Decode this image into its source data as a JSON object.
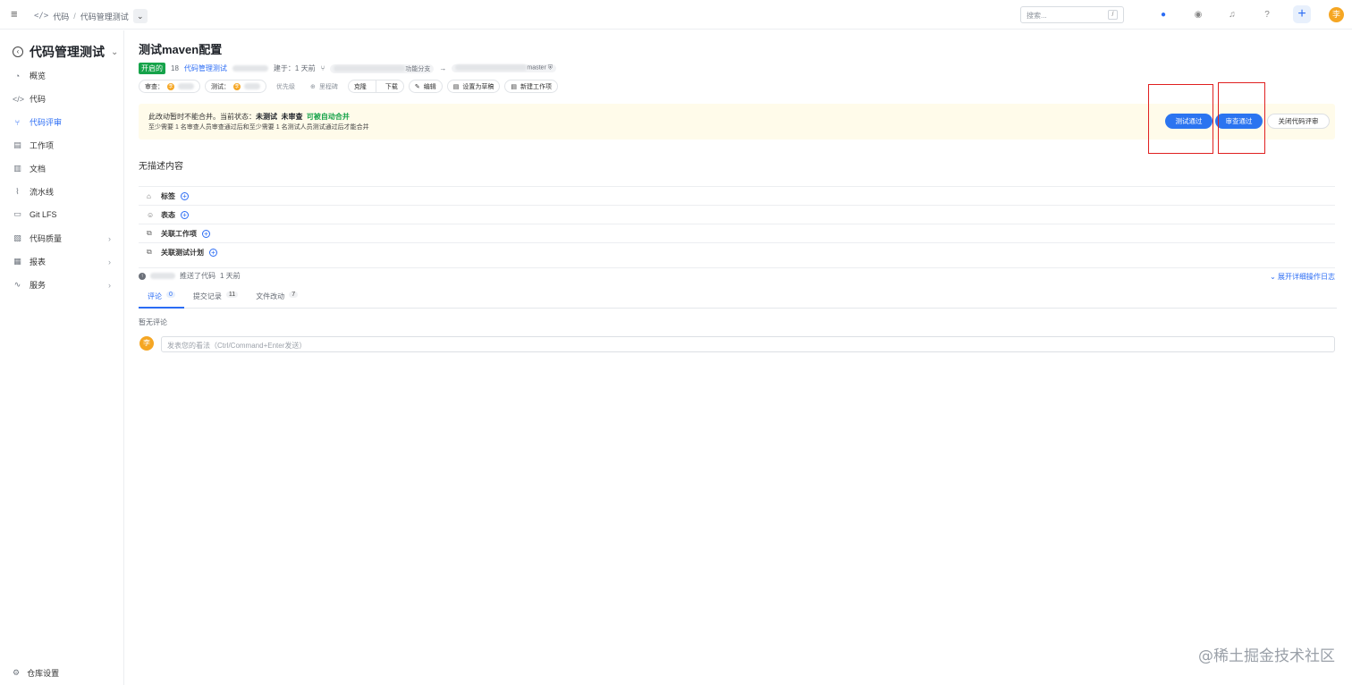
{
  "topbar": {
    "breadcrumb": [
      "代码",
      "代码管理测试"
    ],
    "search_placeholder": "搜索...",
    "search_shortcut": "/",
    "avatar_letter": "李",
    "help_label": "?"
  },
  "sidebar": {
    "project_title": "代码管理测试",
    "items": [
      {
        "label": "概览",
        "icon": "dashboard-icon"
      },
      {
        "label": "代码",
        "icon": "code-icon"
      },
      {
        "label": "代码评审",
        "icon": "merge-request-icon",
        "active": true
      },
      {
        "label": "工作项",
        "icon": "work-item-icon"
      },
      {
        "label": "文档",
        "icon": "document-icon"
      },
      {
        "label": "流水线",
        "icon": "pipeline-icon"
      },
      {
        "label": "Git LFS",
        "icon": "lfs-icon"
      },
      {
        "label": "代码质量",
        "icon": "quality-icon",
        "has_children": true
      },
      {
        "label": "报表",
        "icon": "report-icon",
        "has_children": true
      },
      {
        "label": "服务",
        "icon": "service-icon",
        "has_children": true
      }
    ],
    "settings_label": "仓库设置"
  },
  "mr": {
    "title": "测试maven配置",
    "status": "开启的",
    "id": "18",
    "project_link": "代码管理测试",
    "created": "建于：1 天前",
    "source_branch_suffix": "功能分支",
    "arrow": "→",
    "target_branch": "master"
  },
  "actions": {
    "reviewer_label": "审查：",
    "tester_label": "测试：",
    "priority": "优先级",
    "milestone": "里程碑",
    "clone": "克隆",
    "download": "下载",
    "edit": "编辑",
    "set_draft": "设置为草稿",
    "new_work_item": "新建工作项",
    "avatar_letter": "李"
  },
  "banner": {
    "line1_prefix": "此改动暂时不能合并。当前状态：",
    "status_untested": "未测试",
    "status_unreviewed": "未审查",
    "status_auto_merge": "可被自动合并",
    "line2": "至少需要 1 名审查人员审查通过后和至少需要 1 名测试人员测试通过后才能合并",
    "test_pass_button": "测试通过",
    "review_pass_button": "审查通过",
    "close_review_button": "关闭代码评审"
  },
  "description": "无描述内容",
  "properties": [
    {
      "label": "标签",
      "icon": "tag-icon"
    },
    {
      "label": "表态",
      "icon": "smile-icon"
    },
    {
      "label": "关联工作项",
      "icon": "link-icon"
    },
    {
      "label": "关联测试计划",
      "icon": "link-icon"
    }
  ],
  "activity": {
    "pushed_text": "推送了代码",
    "pushed_time": "1 天前",
    "expand_log": "展开详细操作日志"
  },
  "tabs": [
    {
      "label": "评论",
      "count": "0",
      "active": true
    },
    {
      "label": "提交记录",
      "count": "11"
    },
    {
      "label": "文件改动",
      "count": "7"
    }
  ],
  "comments": {
    "empty_text": "暂无评论",
    "input_placeholder": "发表您的看法（Ctrl/Command+Enter发送）",
    "avatar_letter": "李"
  },
  "watermark": "@稀土掘金技术社区"
}
